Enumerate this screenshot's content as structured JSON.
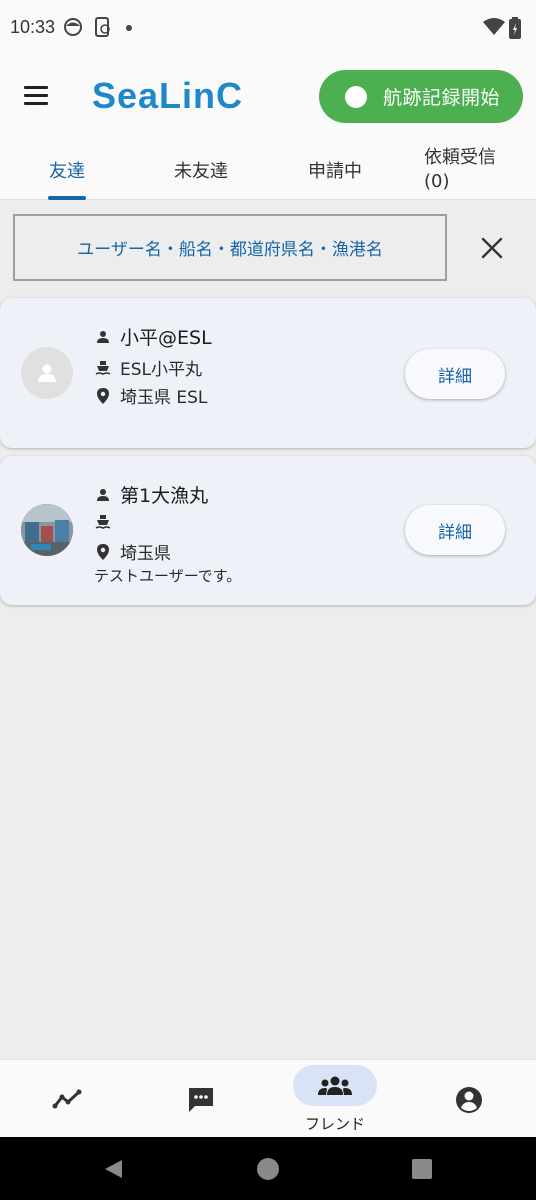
{
  "status_bar": {
    "time": "10:33",
    "icons": [
      "face-icon",
      "sync-icon",
      "dot-icon",
      "wifi-icon",
      "battery-icon"
    ]
  },
  "app_bar": {
    "logo_text": "SeaLinC",
    "record_button_label": "航跡記録開始",
    "accent_color": "#4caf50"
  },
  "tabs": [
    {
      "label": "友達",
      "active": true
    },
    {
      "label": "未友達",
      "active": false
    },
    {
      "label": "申請中",
      "active": false
    },
    {
      "label": "依頼受信",
      "count": "(0)",
      "active": false
    }
  ],
  "search": {
    "placeholder": "ユーザー名・船名・都道府県名・漁港名"
  },
  "friends": [
    {
      "name": "小平@ESL",
      "ship": "ESL小平丸",
      "location": "埼玉県 ESL",
      "note": "",
      "avatar": "default",
      "detail_label": "詳細"
    },
    {
      "name": "第1大漁丸",
      "ship": "",
      "location": "埼玉県",
      "note": "テストユーザーです。",
      "avatar": "photo",
      "detail_label": "詳細"
    }
  ],
  "bottom_nav": {
    "items": [
      {
        "icon": "chart-line-icon",
        "label": ""
      },
      {
        "icon": "chat-icon",
        "label": ""
      },
      {
        "icon": "group-icon",
        "label": "フレンド",
        "active": true
      },
      {
        "icon": "account-icon",
        "label": ""
      }
    ]
  },
  "colors": {
    "primary": "#1565a8",
    "card_bg": "#eef2f8",
    "nav_pill": "#d8e4f6"
  }
}
